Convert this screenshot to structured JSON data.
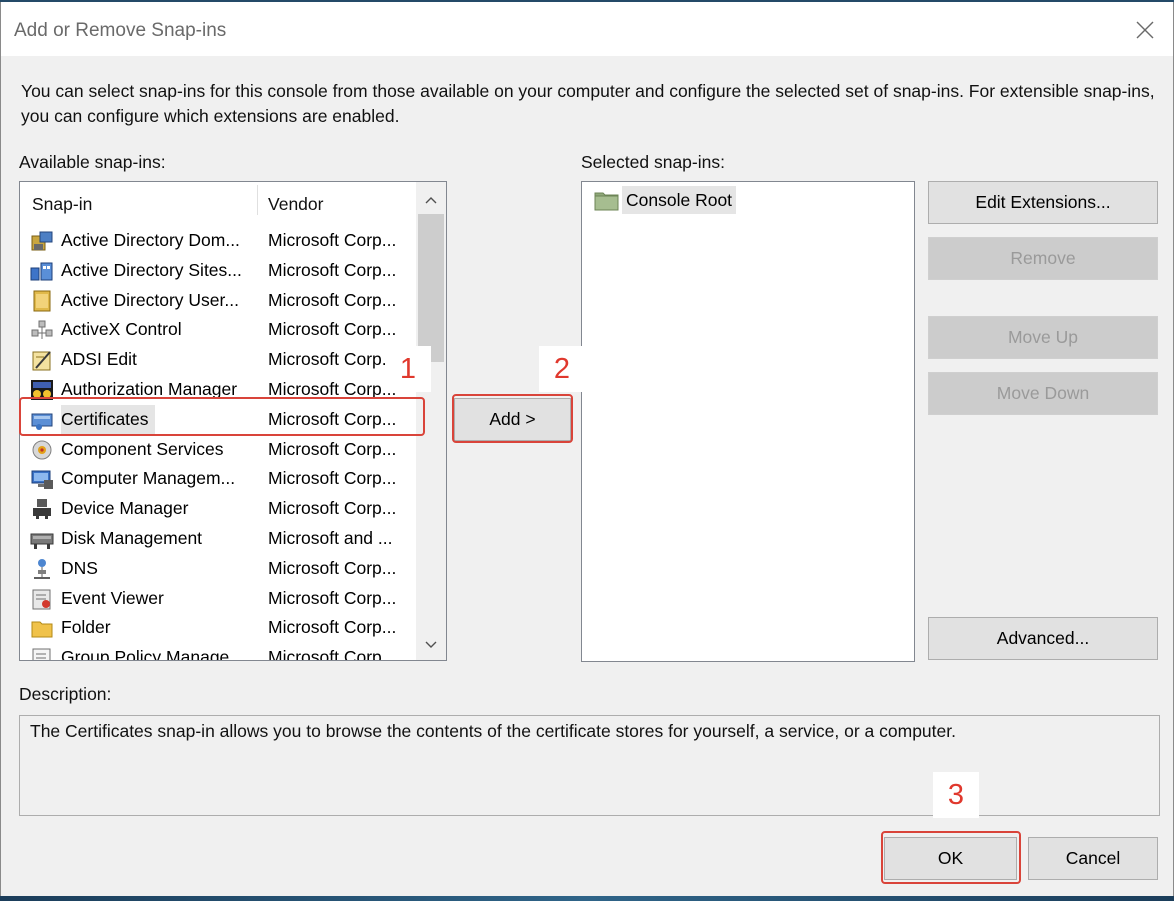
{
  "dialog": {
    "title": "Add or Remove Snap-ins"
  },
  "intro_text": "You can select snap-ins for this console from those available on your computer and configure the selected set of snap-ins. For extensible snap-ins, you can configure which extensions are enabled.",
  "available": {
    "label": "Available snap-ins:",
    "columns": {
      "snapin": "Snap-in",
      "vendor": "Vendor"
    },
    "selected_index": 6,
    "rows": [
      {
        "name": "Active Directory Dom...",
        "vendor": "Microsoft Corp...",
        "icon": "ad-domains-icon"
      },
      {
        "name": "Active Directory Sites...",
        "vendor": "Microsoft Corp...",
        "icon": "ad-sites-icon"
      },
      {
        "name": "Active Directory User...",
        "vendor": "Microsoft Corp...",
        "icon": "ad-users-icon"
      },
      {
        "name": "ActiveX Control",
        "vendor": "Microsoft Corp...",
        "icon": "activex-icon"
      },
      {
        "name": "ADSI Edit",
        "vendor": "Microsoft Corp...",
        "icon": "adsi-edit-icon"
      },
      {
        "name": "Authorization Manager",
        "vendor": "Microsoft Corp...",
        "icon": "authorization-manager-icon"
      },
      {
        "name": "Certificates",
        "vendor": "Microsoft Corp...",
        "icon": "certificates-icon"
      },
      {
        "name": "Component Services",
        "vendor": "Microsoft Corp...",
        "icon": "component-services-icon"
      },
      {
        "name": "Computer Managem...",
        "vendor": "Microsoft Corp...",
        "icon": "computer-management-icon"
      },
      {
        "name": "Device Manager",
        "vendor": "Microsoft Corp...",
        "icon": "device-manager-icon"
      },
      {
        "name": "Disk Management",
        "vendor": "Microsoft and ...",
        "icon": "disk-management-icon"
      },
      {
        "name": "DNS",
        "vendor": "Microsoft Corp...",
        "icon": "dns-icon"
      },
      {
        "name": "Event Viewer",
        "vendor": "Microsoft Corp...",
        "icon": "event-viewer-icon"
      },
      {
        "name": "Folder",
        "vendor": "Microsoft Corp...",
        "icon": "folder-icon"
      },
      {
        "name": "Group Policy Manage...",
        "vendor": "Microsoft Corp...",
        "icon": "group-policy-icon"
      }
    ]
  },
  "add_button": "Add >",
  "selected_snapins": {
    "label": "Selected snap-ins:",
    "items": [
      "Console Root"
    ]
  },
  "side_buttons": {
    "edit_extensions": "Edit Extensions...",
    "remove": "Remove",
    "move_up": "Move Up",
    "move_down": "Move Down",
    "advanced": "Advanced..."
  },
  "description": {
    "label": "Description:",
    "text": "The Certificates snap-in allows you to browse the contents of the certificate stores for yourself, a service, or a computer."
  },
  "footer": {
    "ok": "OK",
    "cancel": "Cancel"
  },
  "annotations": {
    "step1": "1",
    "step2": "2",
    "step3": "3"
  },
  "colors": {
    "annotation_red": "#d9443a",
    "dialog_bg": "#f0f0f0",
    "desktop": "#1e3f5a"
  }
}
